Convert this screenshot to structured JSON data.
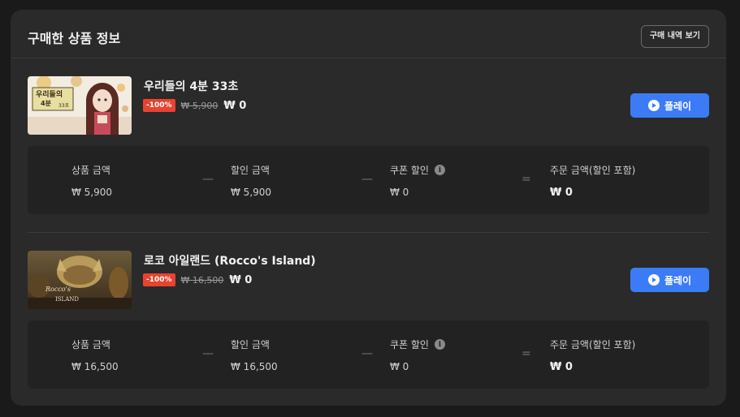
{
  "header": {
    "title": "구매한 상품 정보",
    "history_button": "구매 내역 보기"
  },
  "summary_labels": {
    "product_amount": "상품 금액",
    "discount_amount": "할인 금액",
    "coupon_discount": "쿠폰 할인",
    "order_amount": "주문 금액(할인 포함)",
    "minus": "—",
    "equals": "="
  },
  "play_label": "플레이",
  "products": [
    {
      "name": "우리들의 4분 33초",
      "discount_badge": "-100%",
      "original_price": "₩ 5,900",
      "final_price": "₩ 0",
      "thumbnail_icon": "game-cover-icon",
      "thumbnail_text": [
        "우리들의",
        "4분",
        "33초"
      ],
      "product_amount": "₩ 5,900",
      "discount_amount": "₩ 5,900",
      "coupon_discount": "₩ 0",
      "order_amount": "₩ 0"
    },
    {
      "name": "로코 아일랜드 (Rocco's Island)",
      "discount_badge": "-100%",
      "original_price": "₩ 16,500",
      "final_price": "₩ 0",
      "thumbnail_icon": "game-cover-icon",
      "thumbnail_text": [
        "Rocco's",
        "ISLAND"
      ],
      "product_amount": "₩ 16,500",
      "discount_amount": "₩ 16,500",
      "coupon_discount": "₩ 0",
      "order_amount": "₩ 0"
    }
  ],
  "colors": {
    "accent": "#3b7bf6",
    "badge": "#e8432f",
    "card_bg": "#2a2a2a",
    "page_bg": "#1a1a1a"
  }
}
